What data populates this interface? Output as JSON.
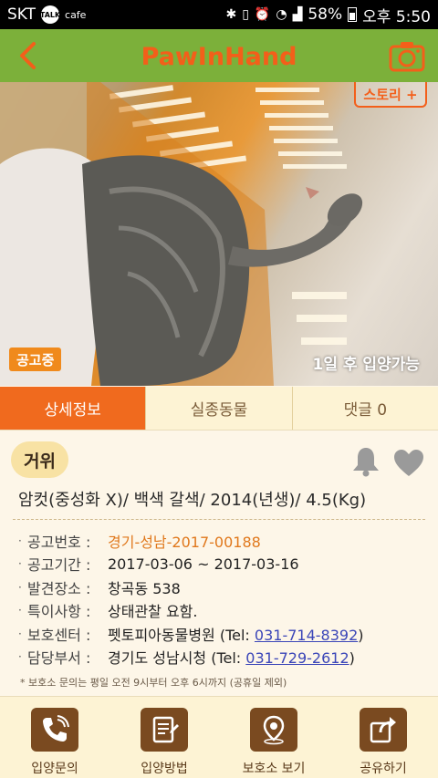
{
  "status_bar": {
    "carrier": "SKT",
    "icon_talk": "TALK",
    "icon_cafe": "cafe",
    "battery": "58%",
    "time": "오후 5:50"
  },
  "header": {
    "logo_text": "PawInHand",
    "brand_color": "#f35f1a",
    "bar_color": "#7cb03a"
  },
  "photo": {
    "story_button": "스토리 +",
    "notice_badge": "공고중",
    "adopt_available": "1일 후 입양가능"
  },
  "tabs": [
    {
      "label": "상세정보",
      "active": true
    },
    {
      "label": "실종동물",
      "active": false
    },
    {
      "label": "댓글 0",
      "active": false
    }
  ],
  "info": {
    "species": "거위",
    "summary": "암컷(중성화 X)/ 백색 갈색/ 2014(년생)/ 4.5(Kg)",
    "rows": [
      {
        "label": "공고번호 :",
        "value": "경기-성남-2017-00188"
      },
      {
        "label": "공고기간 :",
        "value": "2017-03-06 ~ 2017-03-16"
      },
      {
        "label": "발견장소 :",
        "value": "창곡동 538"
      },
      {
        "label": "특이사항 :",
        "value": "상태관찰 요함."
      },
      {
        "label": "보호센터 :",
        "value": "펫토피아동물병원 (Tel: ",
        "phone": "031-714-8392",
        "suffix": ")"
      },
      {
        "label": "담당부서 :",
        "value": "경기도 성남시청 (Tel: ",
        "phone": "031-729-2612",
        "suffix": ")"
      }
    ],
    "footnote": "* 보호소 문의는 평일 오전 9시부터 오후 6시까지 (공휴일 제외)"
  },
  "actions": [
    {
      "label": "입양문의",
      "icon": "phone-icon"
    },
    {
      "label": "입양방법",
      "icon": "document-icon"
    },
    {
      "label": "보호소 보기",
      "icon": "map-pin-icon"
    },
    {
      "label": "공유하기",
      "icon": "share-icon"
    }
  ]
}
